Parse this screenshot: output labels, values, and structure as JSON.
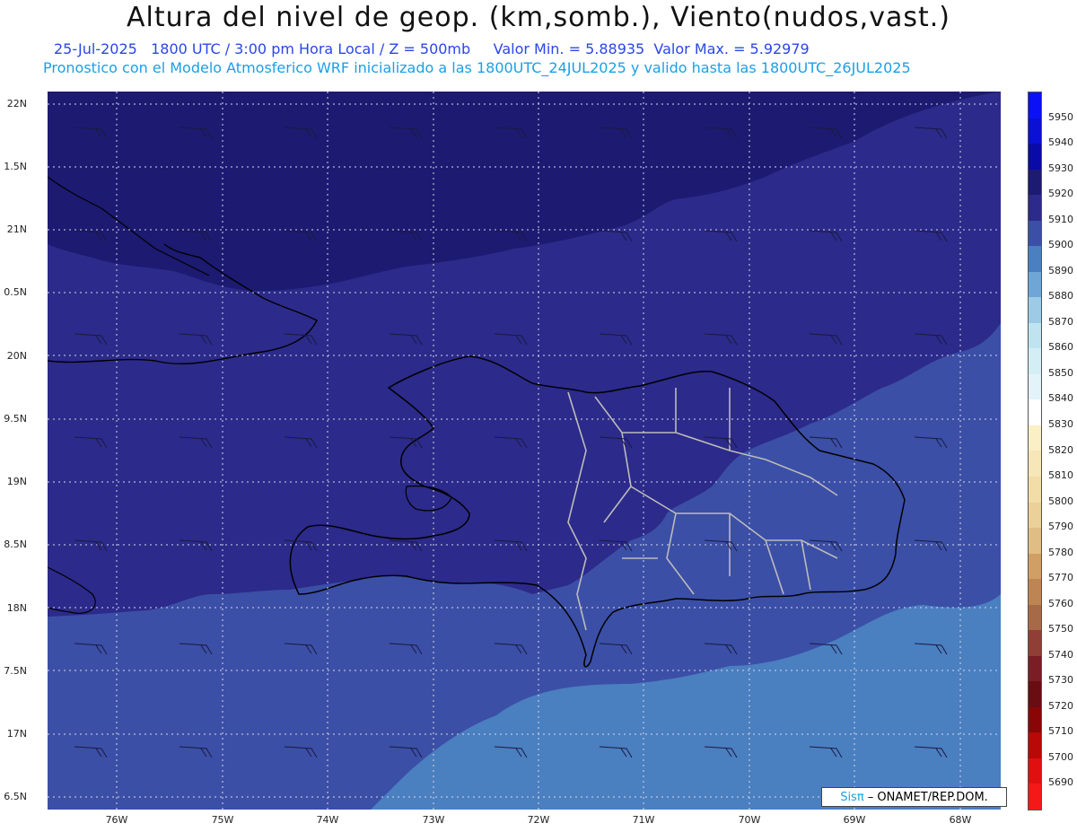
{
  "title": "Altura del nivel de geop. (km,somb.), Viento(nudos,vast.)",
  "subtitle": {
    "date": "25-Jul-2025",
    "time": "1800 UTC / 3:00 pm Hora Local / Z = 500mb",
    "min": "Valor Min. = 5.88935",
    "max": "Valor Max. = 5.92979"
  },
  "forecast_note": "Pronostico con el Modelo Atmosferico WRF inicializado a las 1800UTC_24JUL2025 y valido hasta las 1800UTC_26JUL2025",
  "lat_labels": [
    "22N",
    "1.5N",
    "21N",
    "0.5N",
    "20N",
    "9.5N",
    "19N",
    "8.5N",
    "18N",
    "7.5N",
    "17N",
    "6.5N"
  ],
  "lon_labels": [
    "76W",
    "75W",
    "74W",
    "73W",
    "72W",
    "71W",
    "70W",
    "69W",
    "68W"
  ],
  "colorbar": {
    "labels": [
      "5950",
      "5940",
      "5930",
      "5920",
      "5910",
      "5900",
      "5890",
      "5880",
      "5870",
      "5860",
      "5850",
      "5840",
      "5830",
      "5820",
      "5810",
      "5800",
      "5790",
      "5780",
      "5770",
      "5760",
      "5750",
      "5740",
      "5730",
      "5720",
      "5710",
      "5700",
      "5690"
    ],
    "colors": [
      "#0a12f5",
      "#0a10d4",
      "#0a0aa8",
      "#1d1a72",
      "#2c2a8a",
      "#3b4fa6",
      "#4a7fc0",
      "#6fa6d6",
      "#9dcbe6",
      "#bfe4f0",
      "#d4eef6",
      "#e2f3f9",
      "#ffffff",
      "#fbefc6",
      "#f6e6b8",
      "#f2dca8",
      "#ebd09a",
      "#e0bd84",
      "#cf9f66",
      "#bd8554",
      "#a66a48",
      "#8f3f35",
      "#7a1d24",
      "#6a0d12",
      "#8a0606",
      "#b80808",
      "#e01010",
      "#f51818"
    ]
  },
  "credit": {
    "logo": "Sisπ",
    "text": " – ONAMET/REP.DOM."
  }
}
